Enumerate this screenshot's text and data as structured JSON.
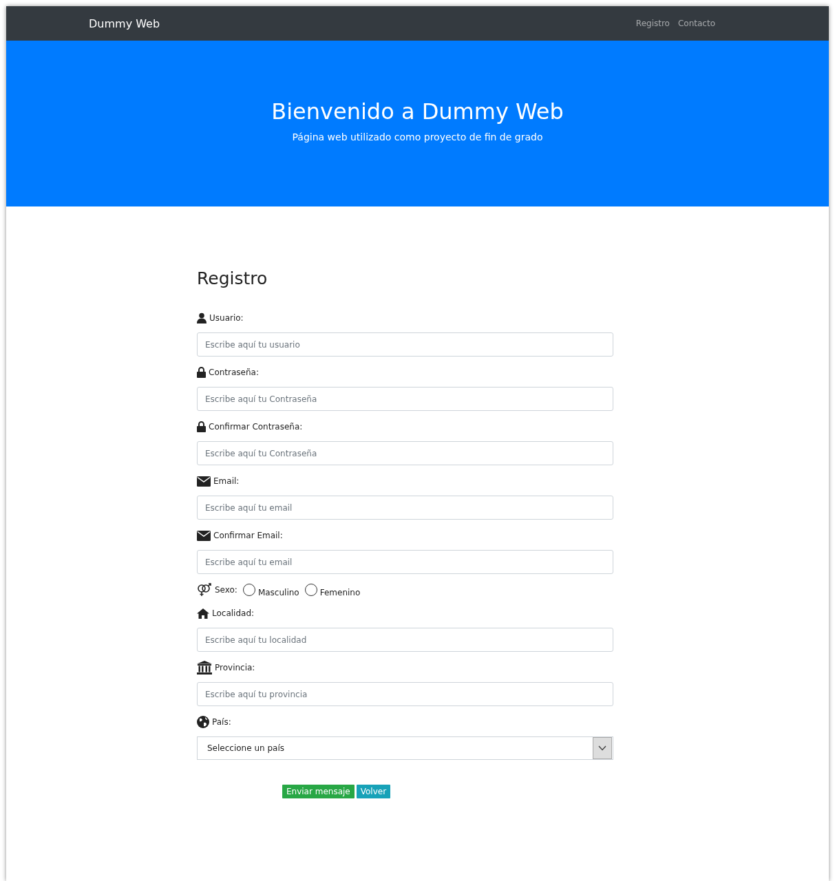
{
  "navbar": {
    "brand": "Dummy Web",
    "links": [
      {
        "label": "Registro"
      },
      {
        "label": "Contacto"
      }
    ]
  },
  "hero": {
    "title": "Bienvenido a Dummy Web",
    "subtitle": "Página web utilizado como proyecto de fin de grado"
  },
  "form": {
    "title": "Registro",
    "fields": [
      {
        "kind": "text",
        "label": "Usuario:",
        "placeholder": "Escribe aquí tu usuario"
      },
      {
        "kind": "text",
        "label": "Contraseña:",
        "placeholder": "Escribe aquí tu Contraseña"
      },
      {
        "kind": "text",
        "label": "Confirmar Contraseña:",
        "placeholder": "Escribe aquí tu Contraseña"
      },
      {
        "kind": "text",
        "label": "Email:",
        "placeholder": "Escribe aquí tu email"
      },
      {
        "kind": "text",
        "label": "Confirmar Email:",
        "placeholder": "Escribe aquí tu email"
      },
      {
        "kind": "radio",
        "label": "Sexo:",
        "options": [
          {
            "label": "Masculino",
            "selected": false
          },
          {
            "label": "Femenino",
            "selected": false
          }
        ]
      },
      {
        "kind": "text",
        "label": "Localidad:",
        "placeholder": "Escribe aquí tu localidad"
      },
      {
        "kind": "text",
        "label": "Provincia:",
        "placeholder": "Escribe aquí tu provincia"
      },
      {
        "kind": "select",
        "label": "País:",
        "value": "Seleccione un país"
      }
    ],
    "buttons": [
      {
        "label": "Enviar mensaje",
        "kind": "success"
      },
      {
        "label": "Volver",
        "kind": "info"
      }
    ]
  }
}
